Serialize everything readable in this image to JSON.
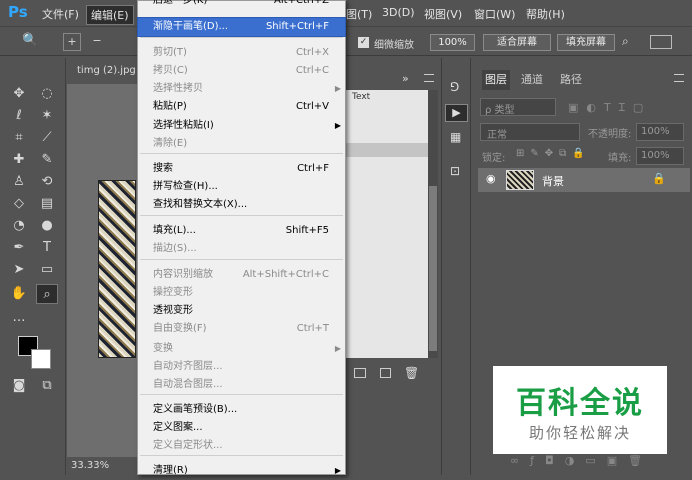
{
  "app": {
    "logo": "Ps"
  },
  "menubar": {
    "file": "文件(F)",
    "edit": "编辑(E)",
    "image_partial": "图像(I)",
    "type_partial": "图(T)",
    "threeD": "3D(D)",
    "view": "视图(V)",
    "window": "窗口(W)",
    "help": "帮助(H)"
  },
  "options": {
    "scrubby_zoom": "细微缩放",
    "zoom100": "100%",
    "fit_screen": "适合屏幕",
    "fill_screen": "填充屏幕"
  },
  "document": {
    "tab_title": "timg (2).jpg",
    "zoom_status": "33.33%"
  },
  "edit_menu": {
    "items": [
      {
        "label": "后退一步(K)",
        "shortcut": "Alt+Ctrl+Z",
        "disabled": false
      },
      {
        "label": "渐隐干画笔(D)...",
        "shortcut": "Shift+Ctrl+F",
        "disabled": false,
        "highlighted": true
      },
      {
        "label": "剪切(T)",
        "shortcut": "Ctrl+X",
        "disabled": true
      },
      {
        "label": "拷贝(C)",
        "shortcut": "Ctrl+C",
        "disabled": true
      },
      {
        "label": "选择性拷贝",
        "shortcut": "",
        "disabled": true,
        "submenu": true
      },
      {
        "label": "粘贴(P)",
        "shortcut": "Ctrl+V",
        "disabled": false
      },
      {
        "label": "选择性粘贴(I)",
        "shortcut": "",
        "disabled": false,
        "submenu": true
      },
      {
        "label": "清除(E)",
        "shortcut": "",
        "disabled": true
      },
      {
        "label": "搜索",
        "shortcut": "Ctrl+F",
        "disabled": false
      },
      {
        "label": "拼写检查(H)...",
        "shortcut": "",
        "disabled": false
      },
      {
        "label": "查找和替换文本(X)...",
        "shortcut": "",
        "disabled": false
      },
      {
        "label": "填充(L)...",
        "shortcut": "Shift+F5",
        "disabled": false
      },
      {
        "label": "描边(S)...",
        "shortcut": "",
        "disabled": true
      },
      {
        "label": "内容识别缩放",
        "shortcut": "Alt+Shift+Ctrl+C",
        "disabled": true
      },
      {
        "label": "操控变形",
        "shortcut": "",
        "disabled": true
      },
      {
        "label": "透视变形",
        "shortcut": "",
        "disabled": false
      },
      {
        "label": "自由变换(F)",
        "shortcut": "Ctrl+T",
        "disabled": true
      },
      {
        "label": "变换",
        "shortcut": "",
        "disabled": true,
        "submenu": true
      },
      {
        "label": "自动对齐图层...",
        "shortcut": "",
        "disabled": true
      },
      {
        "label": "自动混合图层...",
        "shortcut": "",
        "disabled": true
      },
      {
        "label": "定义画笔预设(B)...",
        "shortcut": "",
        "disabled": false
      },
      {
        "label": "定义图案...",
        "shortcut": "",
        "disabled": false
      },
      {
        "label": "定义自定形状...",
        "shortcut": "",
        "disabled": true
      },
      {
        "label": "清理(R)",
        "shortcut": "",
        "disabled": false,
        "submenu": true
      }
    ]
  },
  "mid_panel": {
    "text_label": "Text",
    "collapse": "»"
  },
  "layers_panel": {
    "tabs": [
      "图层",
      "通道",
      "路径"
    ],
    "kind_filter": "ρ 类型",
    "blend_mode": "正常",
    "opacity_label": "不透明度:",
    "opacity_value": "100%",
    "lock_label": "锁定:",
    "fill_label": "填充:",
    "fill_value": "100%",
    "layer_name": "背景"
  },
  "watermark": {
    "title": "百科全说",
    "subtitle": "助你轻松解决"
  },
  "colors": {
    "accent": "#3a6fd0",
    "watermark_green": "#1a9e45"
  }
}
